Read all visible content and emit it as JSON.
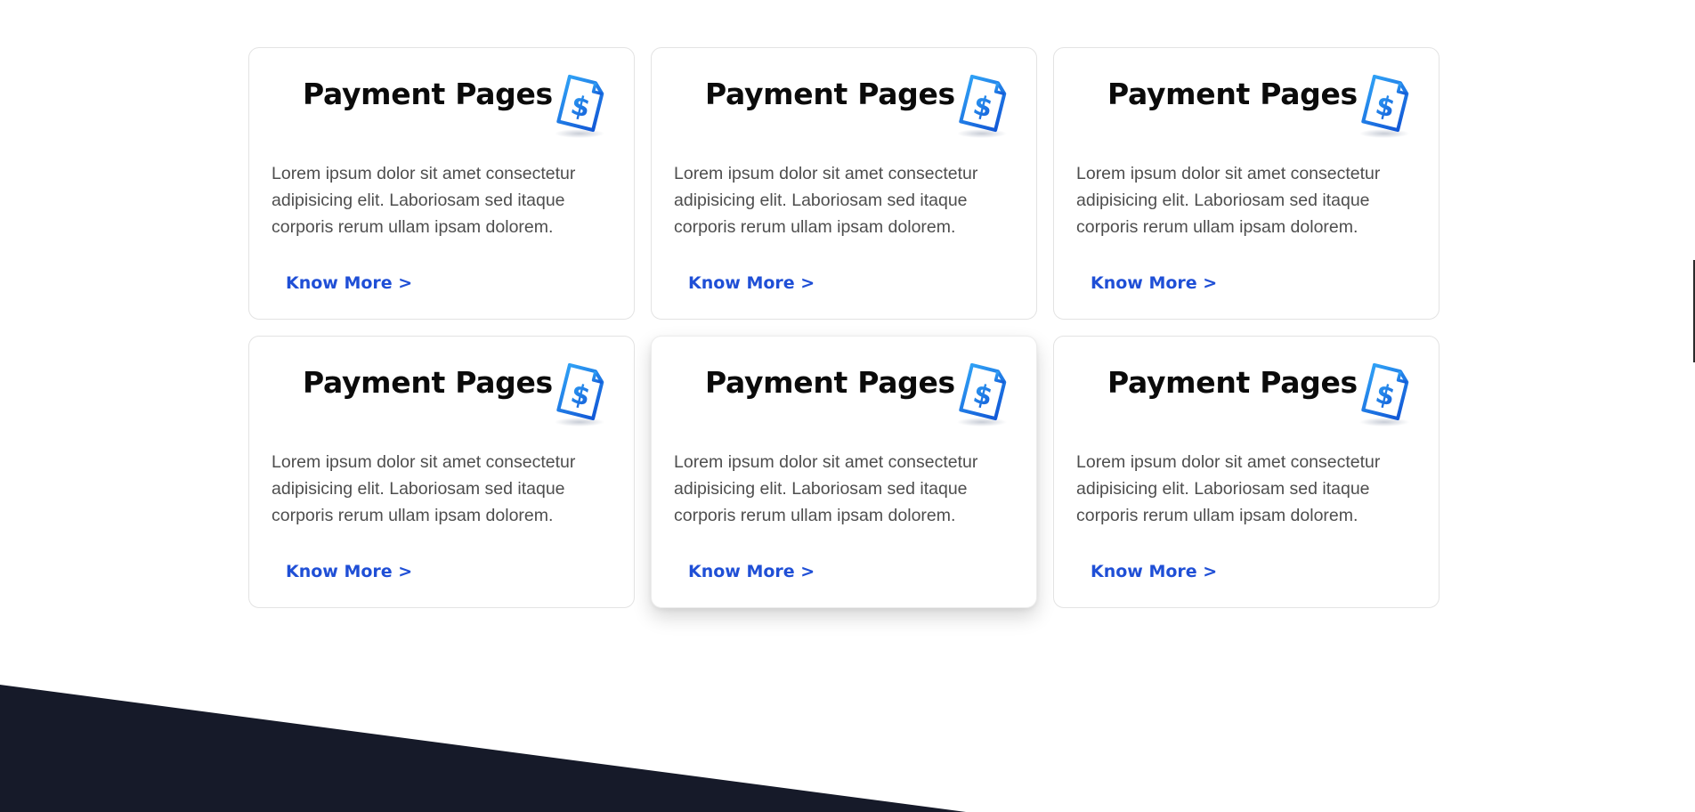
{
  "colors": {
    "title": "#0b0b0b",
    "description": "#4e4e4e",
    "link": "#1f4fd6",
    "icon_gradient_start": "#2d8cf0",
    "icon_gradient_end": "#1060d8",
    "footer": "#161a29"
  },
  "cards": [
    {
      "title": "Payment Pages",
      "icon": "dollar-receipt-icon",
      "description": "Lorem ipsum dolor sit amet consectetur adipisicing elit. Laboriosam sed itaque corporis rerum ullam ipsam dolorem.",
      "link": "Know More >"
    },
    {
      "title": "Payment Pages",
      "icon": "dollar-receipt-icon",
      "description": "Lorem ipsum dolor sit amet consectetur adipisicing elit. Laboriosam sed itaque corporis rerum ullam ipsam dolorem.",
      "link": "Know More >"
    },
    {
      "title": "Payment Pages",
      "icon": "dollar-receipt-icon",
      "description": "Lorem ipsum dolor sit amet consectetur adipisicing elit. Laboriosam sed itaque corporis rerum ullam ipsam dolorem.",
      "link": "Know More >"
    },
    {
      "title": "Payment Pages",
      "icon": "dollar-receipt-icon",
      "description": "Lorem ipsum dolor sit amet consectetur adipisicing elit. Laboriosam sed itaque corporis rerum ullam ipsam dolorem.",
      "link": "Know More >"
    },
    {
      "title": "Payment Pages",
      "icon": "dollar-receipt-icon",
      "description": "Lorem ipsum dolor sit amet consectetur adipisicing elit. Laboriosam sed itaque corporis rerum ullam ipsam dolorem.",
      "link": "Know More >"
    },
    {
      "title": "Payment Pages",
      "icon": "dollar-receipt-icon",
      "description": "Lorem ipsum dolor sit amet consectetur adipisicing elit. Laboriosam sed itaque corporis rerum ullam ipsam dolorem.",
      "link": "Know More >"
    }
  ]
}
